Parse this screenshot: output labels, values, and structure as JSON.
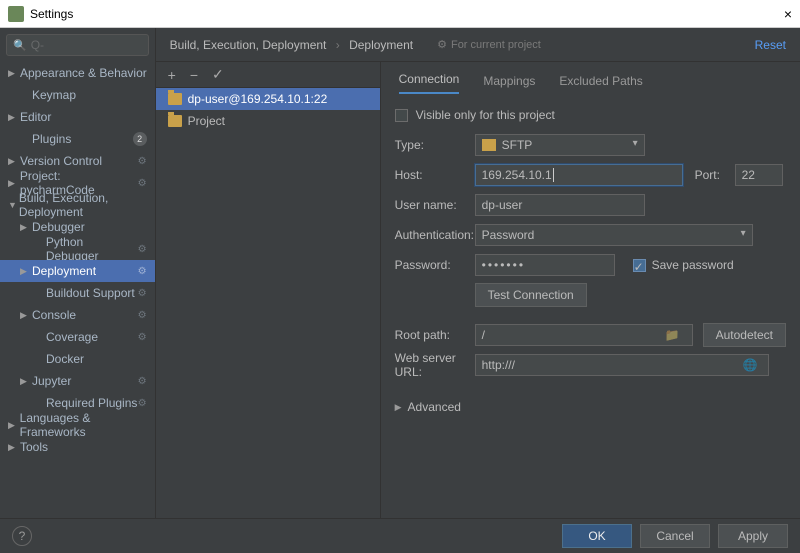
{
  "window": {
    "title": "Settings",
    "close": "×"
  },
  "search": {
    "placeholder": "Q-"
  },
  "sidebar": [
    {
      "label": "Appearance & Behavior",
      "lvl": 1,
      "arrow": "▶"
    },
    {
      "label": "Keymap",
      "lvl": 2
    },
    {
      "label": "Editor",
      "lvl": 1,
      "arrow": "▶"
    },
    {
      "label": "Plugins",
      "lvl": 2,
      "badge": "2"
    },
    {
      "label": "Version Control",
      "lvl": 1,
      "arrow": "▶",
      "fw": true
    },
    {
      "label": "Project: pycharmCode",
      "lvl": 1,
      "arrow": "▶",
      "fw": true
    },
    {
      "label": "Build, Execution, Deployment",
      "lvl": 1,
      "arrow": "▼"
    },
    {
      "label": "Debugger",
      "lvl": 2,
      "arrow": "▶"
    },
    {
      "label": "Python Debugger",
      "lvl": 3,
      "fw": true
    },
    {
      "label": "Deployment",
      "lvl": 2,
      "arrow": "▶",
      "fw": true,
      "sel": true
    },
    {
      "label": "Buildout Support",
      "lvl": 3,
      "fw": true
    },
    {
      "label": "Console",
      "lvl": 2,
      "arrow": "▶",
      "fw": true
    },
    {
      "label": "Coverage",
      "lvl": 3,
      "fw": true
    },
    {
      "label": "Docker",
      "lvl": 3
    },
    {
      "label": "Jupyter",
      "lvl": 2,
      "arrow": "▶",
      "fw": true
    },
    {
      "label": "Required Plugins",
      "lvl": 3,
      "fw": true
    },
    {
      "label": "Languages & Frameworks",
      "lvl": 1,
      "arrow": "▶"
    },
    {
      "label": "Tools",
      "lvl": 1,
      "arrow": "▶"
    }
  ],
  "breadcrumb": {
    "a": "Build, Execution, Deployment",
    "b": "Deployment"
  },
  "for_current": "For current project",
  "reset": "Reset",
  "toolbar": {
    "add": "+",
    "remove": "−",
    "check": "✓"
  },
  "servers": [
    {
      "label": "dp-user@169.254.10.1:22",
      "sel": true
    },
    {
      "label": "Project"
    }
  ],
  "tabs": {
    "connection": "Connection",
    "mappings": "Mappings",
    "excluded": "Excluded Paths"
  },
  "visible_only": "Visible only for this project",
  "fields": {
    "type_lbl": "Type:",
    "type_val": "SFTP",
    "host_lbl": "Host:",
    "host_val": "169.254.10.1",
    "port_lbl": "Port:",
    "port_val": "22",
    "user_lbl": "User name:",
    "user_val": "dp-user",
    "auth_lbl": "Authentication:",
    "auth_val": "Password",
    "pw_lbl": "Password:",
    "pw_val": "•••••••",
    "save_pw": "Save password",
    "test": "Test Connection",
    "root_lbl": "Root path:",
    "root_val": "/",
    "autodetect": "Autodetect",
    "url_lbl": "Web server URL:",
    "url_val": "http:///",
    "advanced": "Advanced"
  },
  "footer": {
    "help": "?",
    "ok": "OK",
    "cancel": "Cancel",
    "apply": "Apply"
  }
}
